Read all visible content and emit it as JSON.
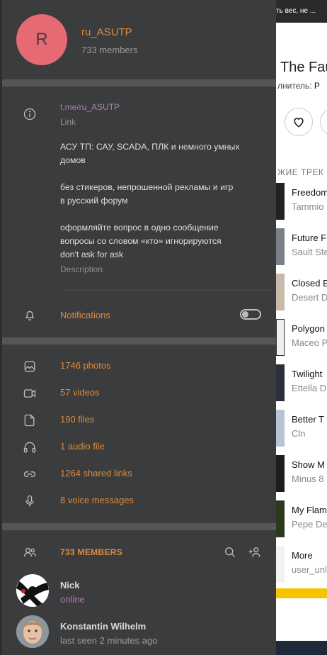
{
  "background_page": {
    "topbar_text": "ть вес, не ...",
    "title": "The Fau",
    "artist_prefix": "лнитель: ",
    "artist_name": "Р",
    "section_title": "ЖИЕ ТРЕК",
    "tracks": [
      {
        "title": "Freedom",
        "artist": "Tammio"
      },
      {
        "title": "Future F",
        "artist": "Sault Ste"
      },
      {
        "title": "Closed E",
        "artist": "Desert D"
      },
      {
        "title": "Polygon",
        "artist": "Maceo P"
      },
      {
        "title": "Twilight",
        "artist": "Ettella D"
      },
      {
        "title": "Better T",
        "artist": "Cln"
      },
      {
        "title": "Show M",
        "artist": "Minus 8"
      },
      {
        "title": "My Flam",
        "artist": "Pepe De"
      },
      {
        "title": "More",
        "artist": "user_unl"
      }
    ]
  },
  "chat": {
    "avatar_letter": "R",
    "name": "ru_ASUTP",
    "members_count": "733 members"
  },
  "info": {
    "link": "t.me/ru_ASUTP",
    "link_caption": "Link",
    "description_lines": [
      "АСУ ТП: САУ, SCADA, ПЛК и немного умных",
      "домов",
      "без стикеров, непрошенной рекламы и игр",
      "в русский форум",
      "оформляйте вопрос в одно сообщение",
      "вопросы со словом «кто» игнорируются",
      "don't ask for ask"
    ],
    "description_caption": "Description"
  },
  "notifications": {
    "label": "Notifications",
    "enabled": false
  },
  "media": [
    {
      "icon": "photo-icon",
      "label": "1746 photos"
    },
    {
      "icon": "video-icon",
      "label": "57 videos"
    },
    {
      "icon": "file-icon",
      "label": "190 files"
    },
    {
      "icon": "headphones-icon",
      "label": "1 audio file"
    },
    {
      "icon": "link-icon",
      "label": "1264 shared links"
    },
    {
      "icon": "microphone-icon",
      "label": "8 voice messages"
    }
  ],
  "members_section": {
    "title": "733 MEMBERS",
    "members": [
      {
        "name": "Nick",
        "status": "online",
        "status_color": "#b07bb4"
      },
      {
        "name": "Konstantin Wilhelm",
        "status": "last seen 2 minutes ago",
        "status_color": "#9a9a9a"
      }
    ]
  },
  "colors": {
    "accent": "#e08a3c",
    "panel_bg": "#3b3c3d",
    "divider": "#555657",
    "link": "#b07bb4",
    "avatar_bg": "#e56a74"
  }
}
